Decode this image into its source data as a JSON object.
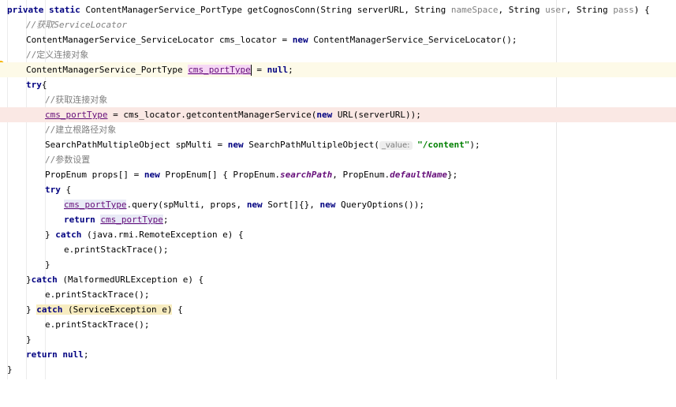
{
  "code": {
    "l01": {
      "kw1": "private static",
      "t1": " ContentManagerService_PortType getCognosConn(String serverURL, String ",
      "p1": "nameSpace",
      "t2": ", String ",
      "p2": "user",
      "t3": ", String ",
      "p3": "pass",
      "t4": ") {"
    },
    "l02": {
      "c1": "//获取",
      "c2": "ServiceLocator"
    },
    "l03": {
      "t1": "ContentManagerService_ServiceLocator cms_locator = ",
      "kw": "new",
      "t2": " ContentManagerService_ServiceLocator();"
    },
    "l04": {
      "c": "//定义连接对象"
    },
    "l05": {
      "t1": "ContentManagerService_PortType ",
      "f": "cms_portType",
      "t2": " = ",
      "kw": "null",
      "t3": ";"
    },
    "l06": {
      "kw": "try",
      "t": "{"
    },
    "l07": {
      "c": "//获取连接对象"
    },
    "l08": {
      "f": "cms_portType",
      "t1": " = cms_locator.getcontentManagerService(",
      "kw": "new",
      "t2": " URL(serverURL));"
    },
    "l09": {
      "c": "//建立根路径对象"
    },
    "l10": {
      "t1": "SearchPathMultipleObject spMulti = ",
      "kw": "new",
      "t2": " SearchPathMultipleObject(",
      "hint": "_value:",
      "s": "\"/content\"",
      "t3": ");"
    },
    "l11": {
      "c": "//参数设置"
    },
    "l12": {
      "t1": "PropEnum props[] = ",
      "kw": "new",
      "t2": " PropEnum[] { PropEnum.",
      "sf1": "searchPath",
      "t3": ", PropEnum.",
      "sf2": "defaultName",
      "t4": "};"
    },
    "l13": {
      "kw": "try",
      "t": " {"
    },
    "l14": {
      "f": "cms_portType",
      "t1": ".query(spMulti, props, ",
      "kw1": "new",
      "t2": " Sort[]{}, ",
      "kw2": "new",
      "t3": " QueryOptions());"
    },
    "l15": {
      "kw": "return",
      "t0": " ",
      "f": "cms_portType",
      "t": ";"
    },
    "l16": {
      "t1": "} ",
      "kw": "catch",
      "t2": " (java.rmi.RemoteException e) {"
    },
    "l17": {
      "t": "e.printStackTrace();"
    },
    "l18": {
      "t": "}"
    },
    "l19": {
      "t1": "}",
      "kw": "catch",
      "t2": " (MalformedURLException e) {"
    },
    "l20": {
      "t": "e.printStackTrace();"
    },
    "l21": {
      "t1": "} ",
      "kw": "catch",
      "t2": " (ServiceException e)",
      "t3": " {"
    },
    "l22": {
      "t": "e.printStackTrace();"
    },
    "l23": {
      "t": "}"
    },
    "l24": {
      "kw1": "return",
      "t1": " ",
      "kw2": "null",
      "t2": ";"
    },
    "l25": {
      "t": "}"
    }
  },
  "colors": {
    "keyword": "#000080",
    "comment": "#808080",
    "field": "#660e7a",
    "string": "#008000",
    "caret_line": "#fdfae8",
    "error_line": "#fae8e4"
  },
  "icons": {
    "gutter": "intention-bulb-icon"
  }
}
